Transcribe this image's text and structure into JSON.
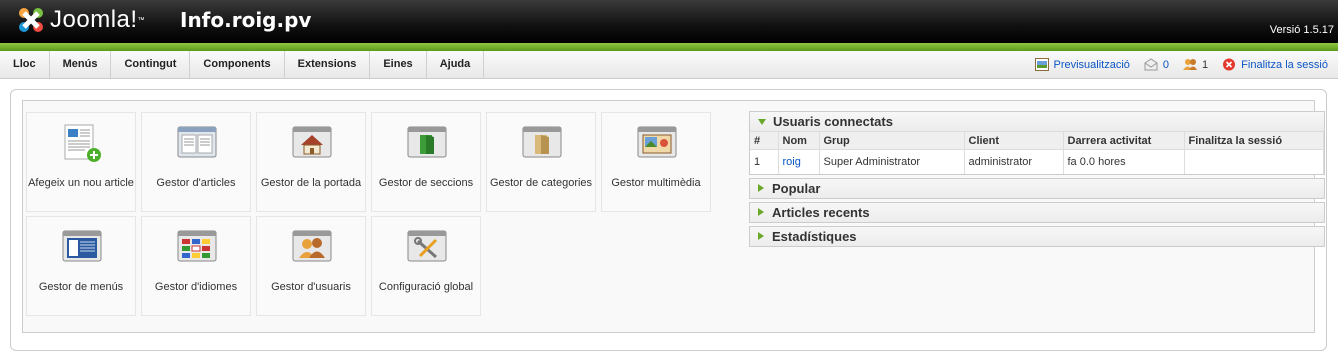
{
  "header": {
    "logo_text": "Joomla!",
    "site_name": "Info.roig.pv",
    "version": "Versió 1.5.17"
  },
  "menu": [
    "Lloc",
    "Menús",
    "Contingut",
    "Components",
    "Extensions",
    "Eines",
    "Ajuda"
  ],
  "status": {
    "preview": "Previsualització",
    "messages": "0",
    "users_online": "1",
    "logout": "Finalitza la sessió"
  },
  "quickicons": [
    {
      "label": "Afegeix un nou article",
      "icon": "add-article-icon"
    },
    {
      "label": "Gestor d'articles",
      "icon": "article-manager-icon"
    },
    {
      "label": "Gestor de la portada",
      "icon": "frontpage-manager-icon"
    },
    {
      "label": "Gestor de seccions",
      "icon": "section-manager-icon"
    },
    {
      "label": "Gestor de categories",
      "icon": "category-manager-icon"
    },
    {
      "label": "Gestor multimèdia",
      "icon": "media-manager-icon"
    },
    {
      "label": "Gestor de menús",
      "icon": "menu-manager-icon"
    },
    {
      "label": "Gestor d'idiomes",
      "icon": "language-manager-icon"
    },
    {
      "label": "Gestor d'usuaris",
      "icon": "user-manager-icon"
    },
    {
      "label": "Configuració global",
      "icon": "global-config-icon"
    }
  ],
  "panels": {
    "logged_in": {
      "title": "Usuaris connectats",
      "columns": [
        "#",
        "Nom",
        "Grup",
        "Client",
        "Darrera activitat",
        "Finalitza la sessió"
      ],
      "rows": [
        {
          "num": "1",
          "name": "roig",
          "group": "Super Administrator",
          "client": "administrator",
          "last_activity": "fa 0.0 hores",
          "logout": ""
        }
      ]
    },
    "popular": "Popular",
    "recent": "Articles recents",
    "stats": "Estadístiques"
  },
  "colors": {
    "accent_green": "#6aa82a",
    "link_blue": "#0b55c4"
  }
}
